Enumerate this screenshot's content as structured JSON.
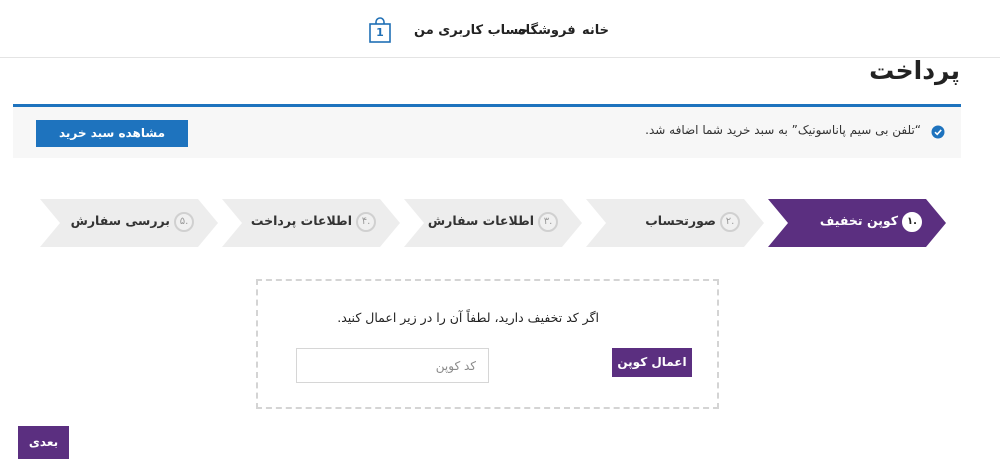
{
  "nav": {
    "home": "خانه",
    "shop": "فروشگاه",
    "account": "حساب کاربری من",
    "cart_count": "1"
  },
  "page_title": "پرداخت",
  "notice": {
    "message": "“تلفن بی سیم پاناسونیک” به سبد خرید شما اضافه شد.",
    "view_cart_label": "مشاهده سبد خرید",
    "accent_color": "#1e73be"
  },
  "steps": [
    {
      "number": ".۱",
      "label": "کوپن تخفیف",
      "active": true
    },
    {
      "number": ".۲",
      "label": "صورتحساب",
      "active": false
    },
    {
      "number": ".۳",
      "label": "اطلاعات سفارش",
      "active": false
    },
    {
      "number": ".۴",
      "label": "اطلاعات پرداخت",
      "active": false
    },
    {
      "number": ".۵",
      "label": "بررسی سفارش",
      "active": false
    }
  ],
  "coupon": {
    "prompt": "اگر کد تخفیف دارید، لطفاً آن را در زیر اعمال کنید.",
    "placeholder": "کد کوپن",
    "value": "",
    "apply_label": "اعمال کوپن"
  },
  "next_label": "بعدی",
  "colors": {
    "brand_purple": "#5b2f80",
    "step_inactive": "#ededed"
  },
  "icons": {
    "cart": "shopping-bag-icon",
    "notice": "check-circle-icon"
  }
}
